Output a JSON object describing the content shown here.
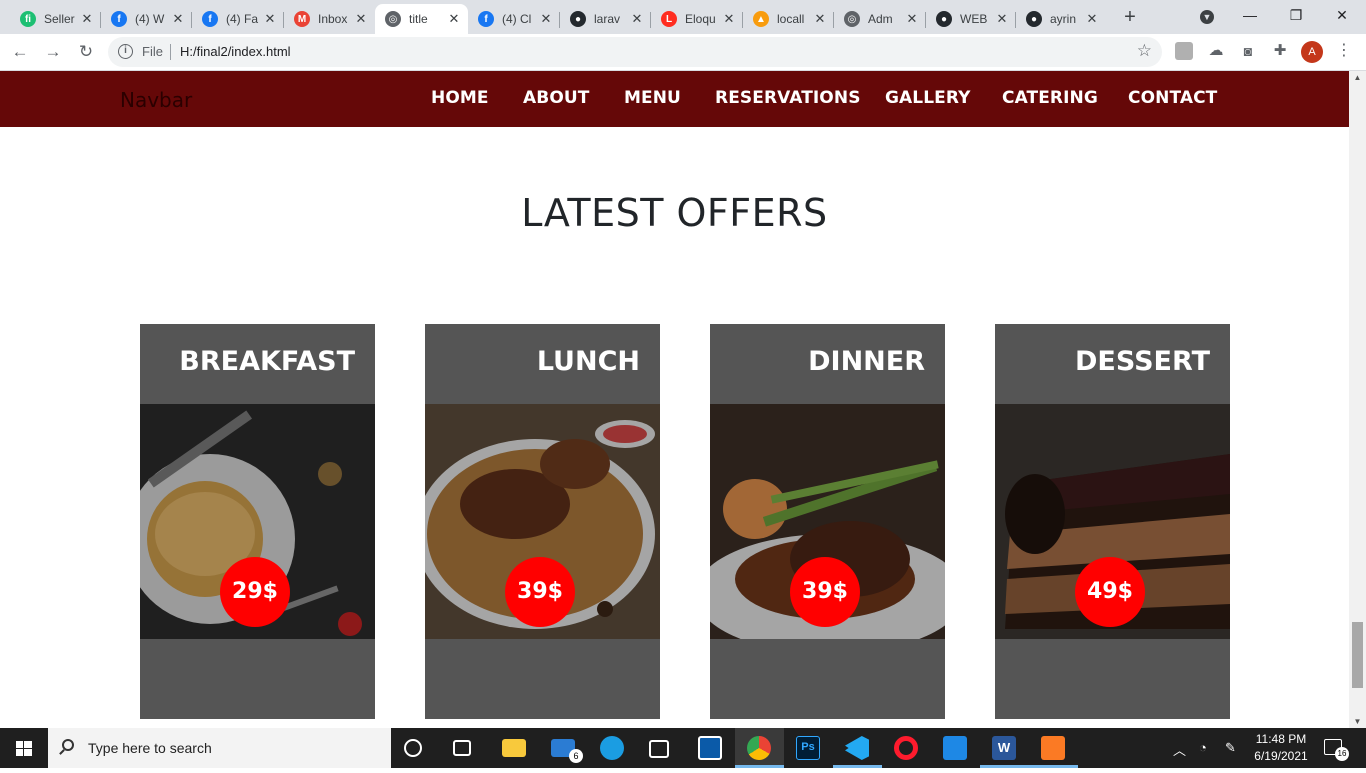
{
  "browser": {
    "tabs": [
      {
        "title": "Seller",
        "favicon": "fiverr-icon",
        "color": "#1dbf73",
        "glyph": "fi"
      },
      {
        "title": "(4) W",
        "favicon": "facebook-icon",
        "color": "#1877f2",
        "glyph": "f"
      },
      {
        "title": "(4) Fa",
        "favicon": "facebook-icon",
        "color": "#1877f2",
        "glyph": "f"
      },
      {
        "title": "Inbox",
        "favicon": "gmail-icon",
        "color": "#ea4335",
        "glyph": "M"
      },
      {
        "title": "title",
        "favicon": "globe-icon",
        "color": "#5f6368",
        "glyph": "◎",
        "active": true
      },
      {
        "title": "(4) Cl",
        "favicon": "facebook-icon",
        "color": "#1877f2",
        "glyph": "f"
      },
      {
        "title": "larav",
        "favicon": "github-icon",
        "color": "#24292e",
        "glyph": "●"
      },
      {
        "title": "Eloqu",
        "favicon": "laravel-icon",
        "color": "#ff2d20",
        "glyph": "L"
      },
      {
        "title": "locall",
        "favicon": "phpmyadmin-icon",
        "color": "#f89c0e",
        "glyph": "▲"
      },
      {
        "title": "Adm",
        "favicon": "globe-icon",
        "color": "#5f6368",
        "glyph": "◎"
      },
      {
        "title": "WEB",
        "favicon": "github-icon",
        "color": "#24292e",
        "glyph": "●"
      },
      {
        "title": "ayrin",
        "favicon": "github-icon",
        "color": "#24292e",
        "glyph": "●"
      }
    ],
    "new_tab": "+",
    "address": {
      "scheme_label": "File",
      "url": "H:/final2/index.html"
    },
    "profile_initial": "A"
  },
  "site": {
    "brand": "Navbar",
    "nav": [
      "HOME",
      "ABOUT",
      "MENU",
      "RESERVATIONS",
      "GALLERY",
      "CATERING",
      "CONTACT"
    ],
    "section_title": "LATEST OFFERS",
    "offers": [
      {
        "name": "BREAKFAST",
        "price": "29$",
        "image": "breakfast-photo"
      },
      {
        "name": "LUNCH",
        "price": "39$",
        "image": "lunch-photo"
      },
      {
        "name": "DINNER",
        "price": "39$",
        "image": "dinner-photo"
      },
      {
        "name": "DESSERT",
        "price": "49$",
        "image": "dessert-photo"
      }
    ],
    "colors": {
      "navbar": "#650808",
      "card": "#555555",
      "price_badge": "#ff0000"
    }
  },
  "taskbar": {
    "search_placeholder": "Type here to search",
    "mail_badge": "6",
    "time": "11:48 PM",
    "date": "6/19/2021",
    "notifications": "16"
  }
}
